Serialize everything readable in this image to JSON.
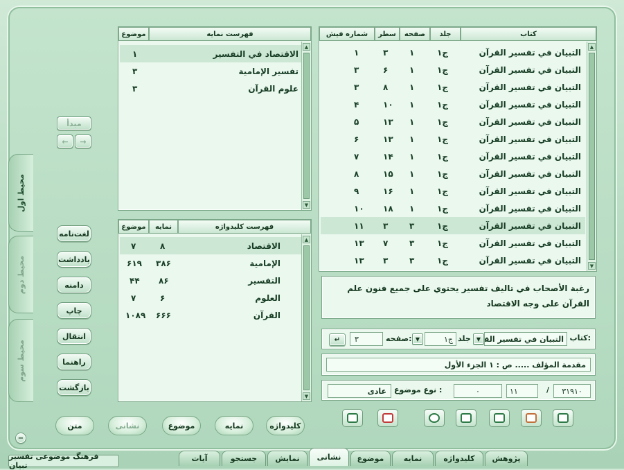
{
  "app_title": "فرهنگ موضوعی تفسیر تبیان",
  "side_tabs": [
    "محیط اول",
    "محیط دوم",
    "محیط سوم"
  ],
  "left_nav": {
    "start_label": "مبدأ",
    "prev": "←",
    "next": "→"
  },
  "left_buttons": [
    "لغت‌نامه",
    "یادداشت",
    "دامنه",
    "چاپ",
    "انتقال",
    "راهنما",
    "بازگشت"
  ],
  "index_panel": {
    "title": "فهرست نمایه",
    "col_topic": "موضوع",
    "rows": [
      {
        "term": "الاقتصاد في التفسير",
        "topic": "۱"
      },
      {
        "term": "تفسير الإمامية",
        "topic": "۳"
      },
      {
        "term": "علوم القرآن",
        "topic": "۳"
      }
    ]
  },
  "keyword_panel": {
    "title": "فهرست کلیدواژه",
    "col_index": "نمایه",
    "col_topic": "موضوع",
    "rows": [
      {
        "term": "الاقتصاد",
        "index": "۸",
        "topic": "۷"
      },
      {
        "term": "الإمامية",
        "index": "۳۸۶",
        "topic": "۶۱۹"
      },
      {
        "term": "التفسير",
        "index": "۸۶",
        "topic": "۴۴"
      },
      {
        "term": "العلوم",
        "index": "۶",
        "topic": "۷"
      },
      {
        "term": "القرآن",
        "index": "۶۶۶",
        "topic": "۱۰۸۹"
      }
    ]
  },
  "book_table": {
    "headers": {
      "book": "کتاب",
      "volume": "جلد",
      "page": "صفحه",
      "line": "سطر",
      "record": "شماره فیش"
    },
    "rows": [
      {
        "book": "التبيان في تفسير القرآن",
        "volume": "ج۱",
        "page": "۱",
        "line": "۳",
        "record": "۱"
      },
      {
        "book": "التبيان في تفسير القرآن",
        "volume": "ج۱",
        "page": "۱",
        "line": "۶",
        "record": "۳"
      },
      {
        "book": "التبيان في تفسير القرآن",
        "volume": "ج۱",
        "page": "۱",
        "line": "۸",
        "record": "۳"
      },
      {
        "book": "التبيان في تفسير القرآن",
        "volume": "ج۱",
        "page": "۱",
        "line": "۱۰",
        "record": "۴"
      },
      {
        "book": "التبيان في تفسير القرآن",
        "volume": "ج۱",
        "page": "۱",
        "line": "۱۳",
        "record": "۵"
      },
      {
        "book": "التبيان في تفسير القرآن",
        "volume": "ج۱",
        "page": "۱",
        "line": "۱۳",
        "record": "۶"
      },
      {
        "book": "التبيان في تفسير القرآن",
        "volume": "ج۱",
        "page": "۱",
        "line": "۱۴",
        "record": "۷"
      },
      {
        "book": "التبيان في تفسير القرآن",
        "volume": "ج۱",
        "page": "۱",
        "line": "۱۵",
        "record": "۸"
      },
      {
        "book": "التبيان في تفسير القرآن",
        "volume": "ج۱",
        "page": "۱",
        "line": "۱۶",
        "record": "۹"
      },
      {
        "book": "التبيان في تفسير القرآن",
        "volume": "ج۱",
        "page": "۱",
        "line": "۱۸",
        "record": "۱۰"
      },
      {
        "book": "التبيان في تفسير القرآن",
        "volume": "ج۱",
        "page": "۳",
        "line": "۳",
        "record": "۱۱"
      },
      {
        "book": "التبيان في تفسير القرآن",
        "volume": "ج۱",
        "page": "۳",
        "line": "۷",
        "record": "۱۳"
      },
      {
        "book": "التبيان في تفسير القرآن",
        "volume": "ج۱",
        "page": "۳",
        "line": "۳",
        "record": "۱۳"
      }
    ]
  },
  "text_preview": "رغبة الأصحاب في تاليف تفسير يحتوي على جميع فنون علم القرآن على وجه الاقتصاد",
  "nav_bar": {
    "book_label": "کتاب:",
    "book_value": "التبيان في تفسير القر",
    "volume_label": "جلد",
    "volume_value": "ج۱",
    "page_label": "صفحه:",
    "page_value": "۳"
  },
  "chapter_text": "مقدمة المؤلف ..... ص : ۱ الجزء الأول",
  "status": {
    "total": "۳۱۹۱۰",
    "current": "۱۱",
    "zero": "۰",
    "topic_type_label": "نوع موضوع :",
    "topic_type_value": "عادی"
  },
  "bottom_pills": [
    "کلیدواژه",
    "نمایه",
    "موضوع",
    "نشانی",
    "متن"
  ],
  "bottom_tabs": [
    "پژوهش",
    "کلیدواژه",
    "نمایه",
    "موضوع",
    "نشانی",
    "نمایش",
    "جستجو",
    "آیات"
  ]
}
